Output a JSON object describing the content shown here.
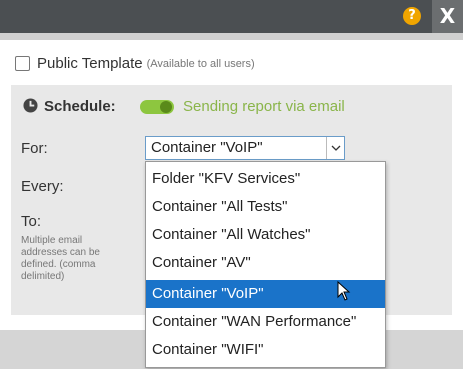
{
  "titlebar": {
    "help_icon": "question-circle-icon",
    "help_glyph": "?",
    "close_glyph": "X"
  },
  "public_template": {
    "label": "Public Template",
    "note": "(Available to all users)",
    "checked": false
  },
  "schedule": {
    "label": "Schedule:",
    "toggle_on": true,
    "toggle_text": "Sending report via email"
  },
  "form": {
    "for_label": "For:",
    "every_label": "Every:",
    "to_label": "To:",
    "to_note": "Multiple email addresses can be defined. (comma delimited)"
  },
  "select": {
    "value": "Container \"VoIP\"",
    "options": [
      "Folder \"KFV Services\"",
      "Container \"All Tests\"",
      "Container \"All Watches\"",
      "Container \"AV\"",
      "Container \"VoIP\"",
      "Container \"WAN Performance\"",
      "Container \"WIFI\""
    ],
    "selected_index": 4
  },
  "colors": {
    "titlebar": "#4b4f52",
    "help": "#f0a500",
    "toggle": "#8dc63f",
    "toggle_text": "#8ab54a",
    "selected_option": "#1a73c9"
  }
}
